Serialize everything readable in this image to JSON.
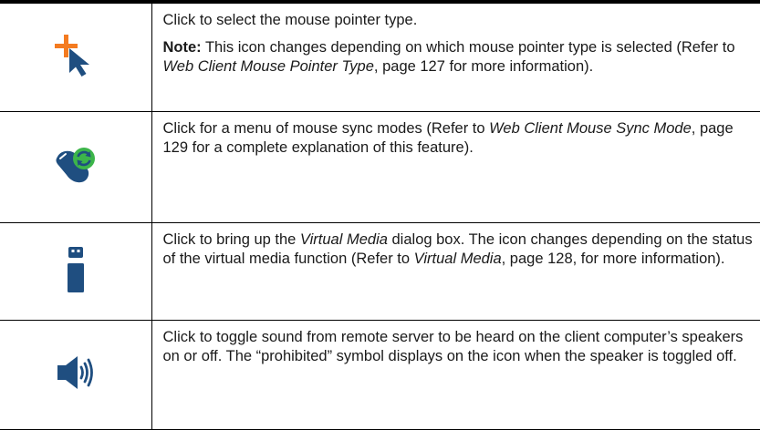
{
  "rows": [
    {
      "icon": "mouse-pointer-type-icon",
      "paragraphs": [
        {
          "text": "Click to select the mouse pointer type."
        },
        {
          "note_label": "Note:",
          "text_before": " This icon changes depending on which mouse pointer type is selected (Refer to ",
          "ref": "Web Client Mouse Pointer Type",
          "text_after": ", page 127 for more information)."
        }
      ]
    },
    {
      "icon": "mouse-sync-icon",
      "paragraphs": [
        {
          "text_before": "Click for a menu of mouse sync modes (Refer to ",
          "ref": "Web Client Mouse Sync Mode",
          "text_after": ", page 129 for a complete explanation of this feature)."
        }
      ]
    },
    {
      "icon": "virtual-media-icon",
      "paragraphs": [
        {
          "text_before": "Click to bring up the ",
          "ref": "Virtual Media",
          "text_middle": " dialog box. The icon changes depending on the status of the virtual media function (Refer to ",
          "ref2": "Virtual Media",
          "text_after": ", page 128, for more information)."
        }
      ]
    },
    {
      "icon": "speaker-icon",
      "paragraphs": [
        {
          "text": "Click to toggle sound from remote server to be heard on the client computer’s speakers on or off. The “prohibited” symbol displays on the icon when the speaker is toggled off."
        }
      ]
    }
  ],
  "colors": {
    "accent_orange": "#f47b20",
    "icon_navy": "#1f4e80",
    "sync_green": "#3cb54a",
    "rule": "#000000"
  }
}
